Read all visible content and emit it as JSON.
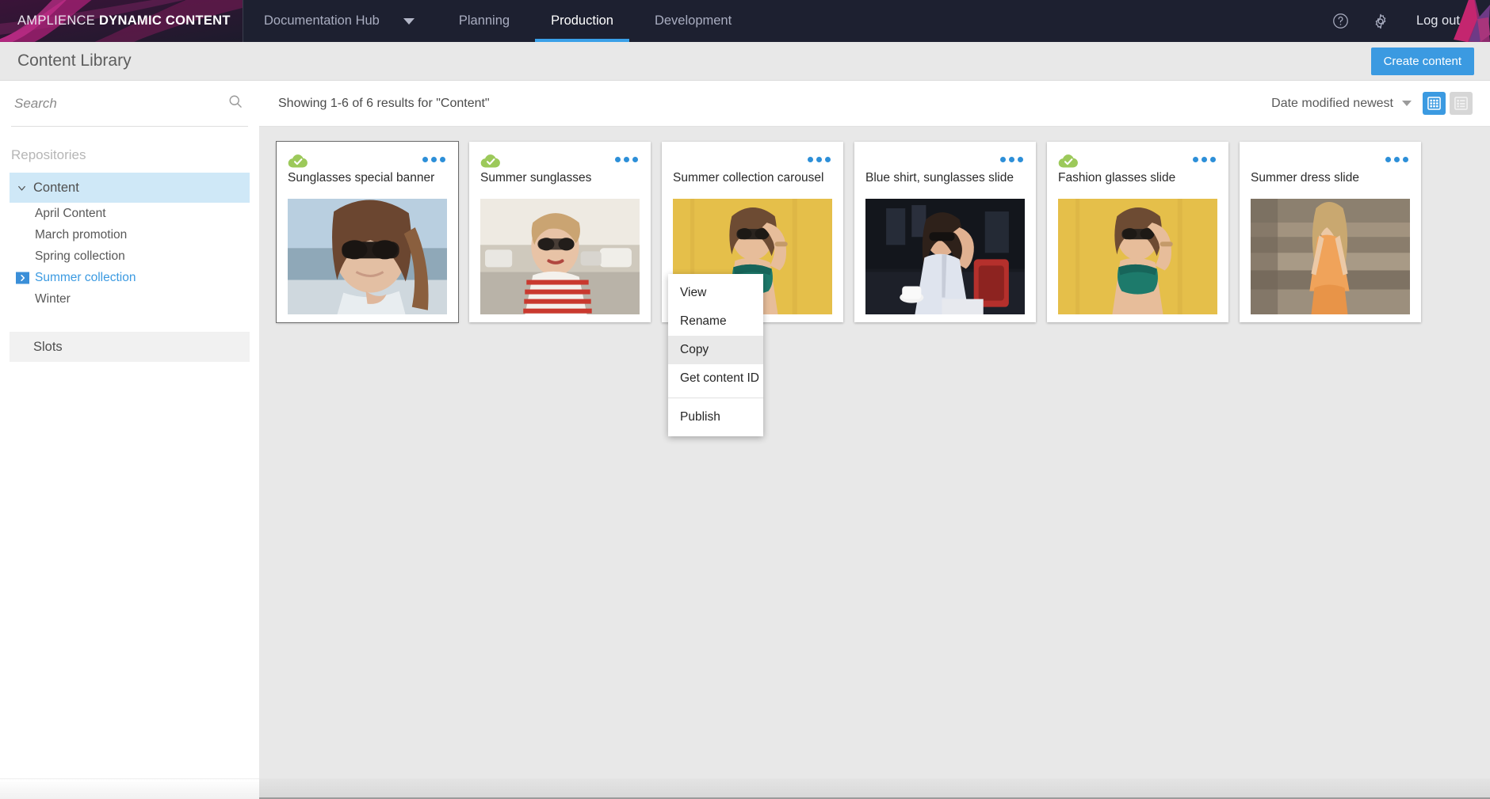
{
  "topnav": {
    "brand_prefix": "AMPLIENCE ",
    "brand_strong": "DYNAMIC CONTENT",
    "items": [
      {
        "label": "Documentation Hub",
        "active": false,
        "caret": true
      },
      {
        "label": "Planning",
        "active": false,
        "caret": false
      },
      {
        "label": "Production",
        "active": true,
        "caret": false
      },
      {
        "label": "Development",
        "active": false,
        "caret": false
      }
    ],
    "help_icon": "question-mark-circle-icon",
    "settings_icon": "gear-icon",
    "logout_label": "Log out",
    "accent_color": "#3aa0e8",
    "bg_color": "#1d2030",
    "brand_color": "#b3247e"
  },
  "pagehead": {
    "title": "Content Library",
    "create_label": "Create content",
    "create_color": "#3b9ae1"
  },
  "sidebar": {
    "search_value": "",
    "search_placeholder": "Search",
    "search_icon": "search-icon",
    "section_label": "Repositories",
    "repository": {
      "label": "Content",
      "expanded": true,
      "selected": true
    },
    "folders": [
      {
        "label": "April Content",
        "active": false
      },
      {
        "label": "March promotion",
        "active": false
      },
      {
        "label": "Spring collection",
        "active": false
      },
      {
        "label": "Summer collection",
        "active": true
      },
      {
        "label": "Winter",
        "active": false
      }
    ],
    "slots_label": "Slots"
  },
  "toolbar": {
    "results_text": "Showing 1-6 of 6 results for \"Content\"",
    "sort_label": "Date modified newest",
    "view_grid_icon": "grid-view-icon",
    "view_list_icon": "list-view-icon",
    "view_active": "grid"
  },
  "cards": [
    {
      "title": "Sunglasses special banner",
      "published": true,
      "focused": true,
      "menu_open": true,
      "image": "woman-in-black-sunglasses-portrait"
    },
    {
      "title": "Summer sunglasses",
      "published": true,
      "focused": false,
      "menu_open": false,
      "image": "woman-in-red-striped-top-street"
    },
    {
      "title": "Summer collection carousel",
      "published": false,
      "focused": false,
      "menu_open": false,
      "image": "woman-on-yellow-wall-green-top"
    },
    {
      "title": "Blue shirt, sunglasses slide",
      "published": false,
      "focused": false,
      "menu_open": false,
      "image": "woman-white-shirt-cafe-night"
    },
    {
      "title": "Fashion glasses slide",
      "published": true,
      "focused": false,
      "menu_open": false,
      "image": "woman-on-yellow-wall-green-top"
    },
    {
      "title": "Summer dress slide",
      "published": false,
      "focused": false,
      "menu_open": false,
      "image": "woman-orange-dress-stone-steps"
    }
  ],
  "context_menu": {
    "items": [
      {
        "label": "View",
        "highlighted": false,
        "divider_after": false
      },
      {
        "label": "Rename",
        "highlighted": false,
        "divider_after": false
      },
      {
        "label": "Copy",
        "highlighted": true,
        "divider_after": false
      },
      {
        "label": "Get content ID",
        "highlighted": false,
        "divider_after": true
      },
      {
        "label": "Publish",
        "highlighted": false,
        "divider_after": false
      }
    ]
  }
}
